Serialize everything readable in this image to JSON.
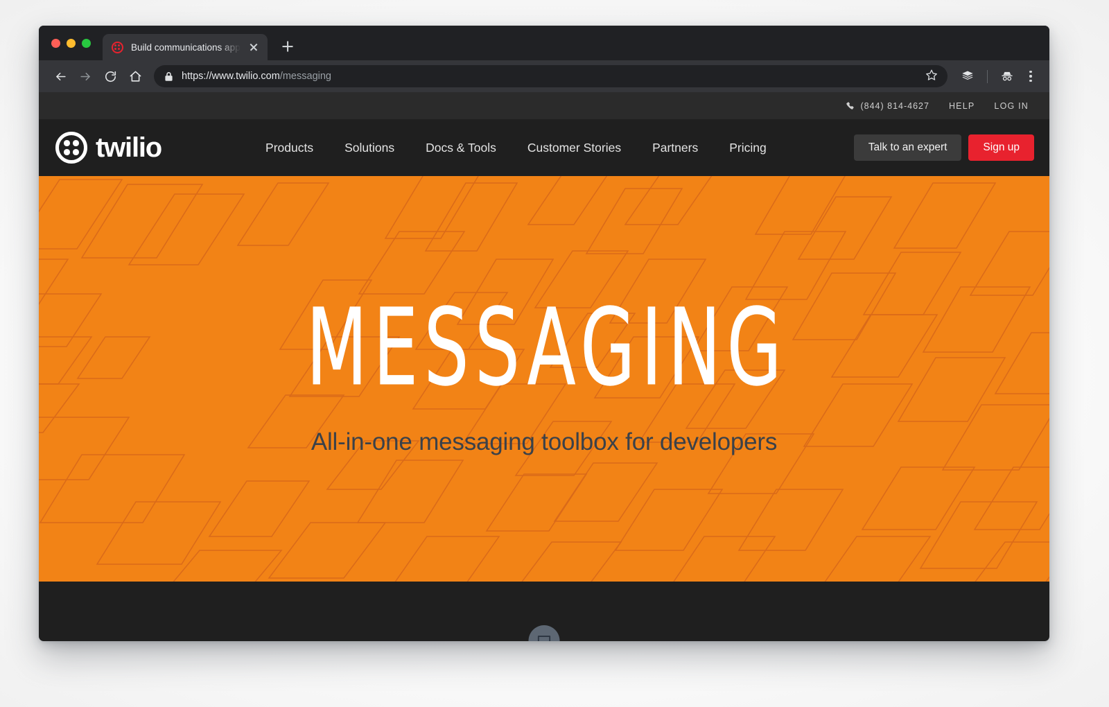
{
  "browser": {
    "tab": {
      "title": "Build communications apps wit",
      "favicon_name": "twilio-favicon",
      "close_label": "Close tab"
    },
    "new_tab_label": "New tab",
    "toolbar": {
      "back_label": "Back",
      "forward_label": "Forward",
      "reload_label": "Reload",
      "home_label": "Home",
      "url_origin": "https://www.twilio.com",
      "url_path": "/messaging",
      "lock_label": "Secure",
      "bookmark_label": "Bookmark this page",
      "extensions_label": "Extensions",
      "profile_label": "Incognito",
      "menu_label": "Customize and control"
    }
  },
  "site": {
    "utility": {
      "phone": "(844) 814-4627",
      "help": "HELP",
      "login": "LOG IN"
    },
    "logo": {
      "wordmark": "twilio"
    },
    "nav": [
      {
        "label": "Products"
      },
      {
        "label": "Solutions"
      },
      {
        "label": "Docs & Tools"
      },
      {
        "label": "Customer Stories"
      },
      {
        "label": "Partners"
      },
      {
        "label": "Pricing"
      }
    ],
    "cta": {
      "expert": "Talk to an expert",
      "signup": "Sign up"
    },
    "hero": {
      "title": "MESSAGING",
      "subtitle": "All-in-one messaging toolbox for developers"
    },
    "footer": {
      "chat_label": "Open chat"
    }
  },
  "colors": {
    "hero_orange": "#F28316",
    "hero_pattern_stroke": "#D9691A",
    "brand_red": "#E8222E",
    "navbar_dark": "#1F1F1F",
    "utility_dark": "#2B2B2B",
    "footer_slate": "#252D38",
    "chat_button": "#5D6773",
    "subtitle_text": "#3B4149"
  }
}
